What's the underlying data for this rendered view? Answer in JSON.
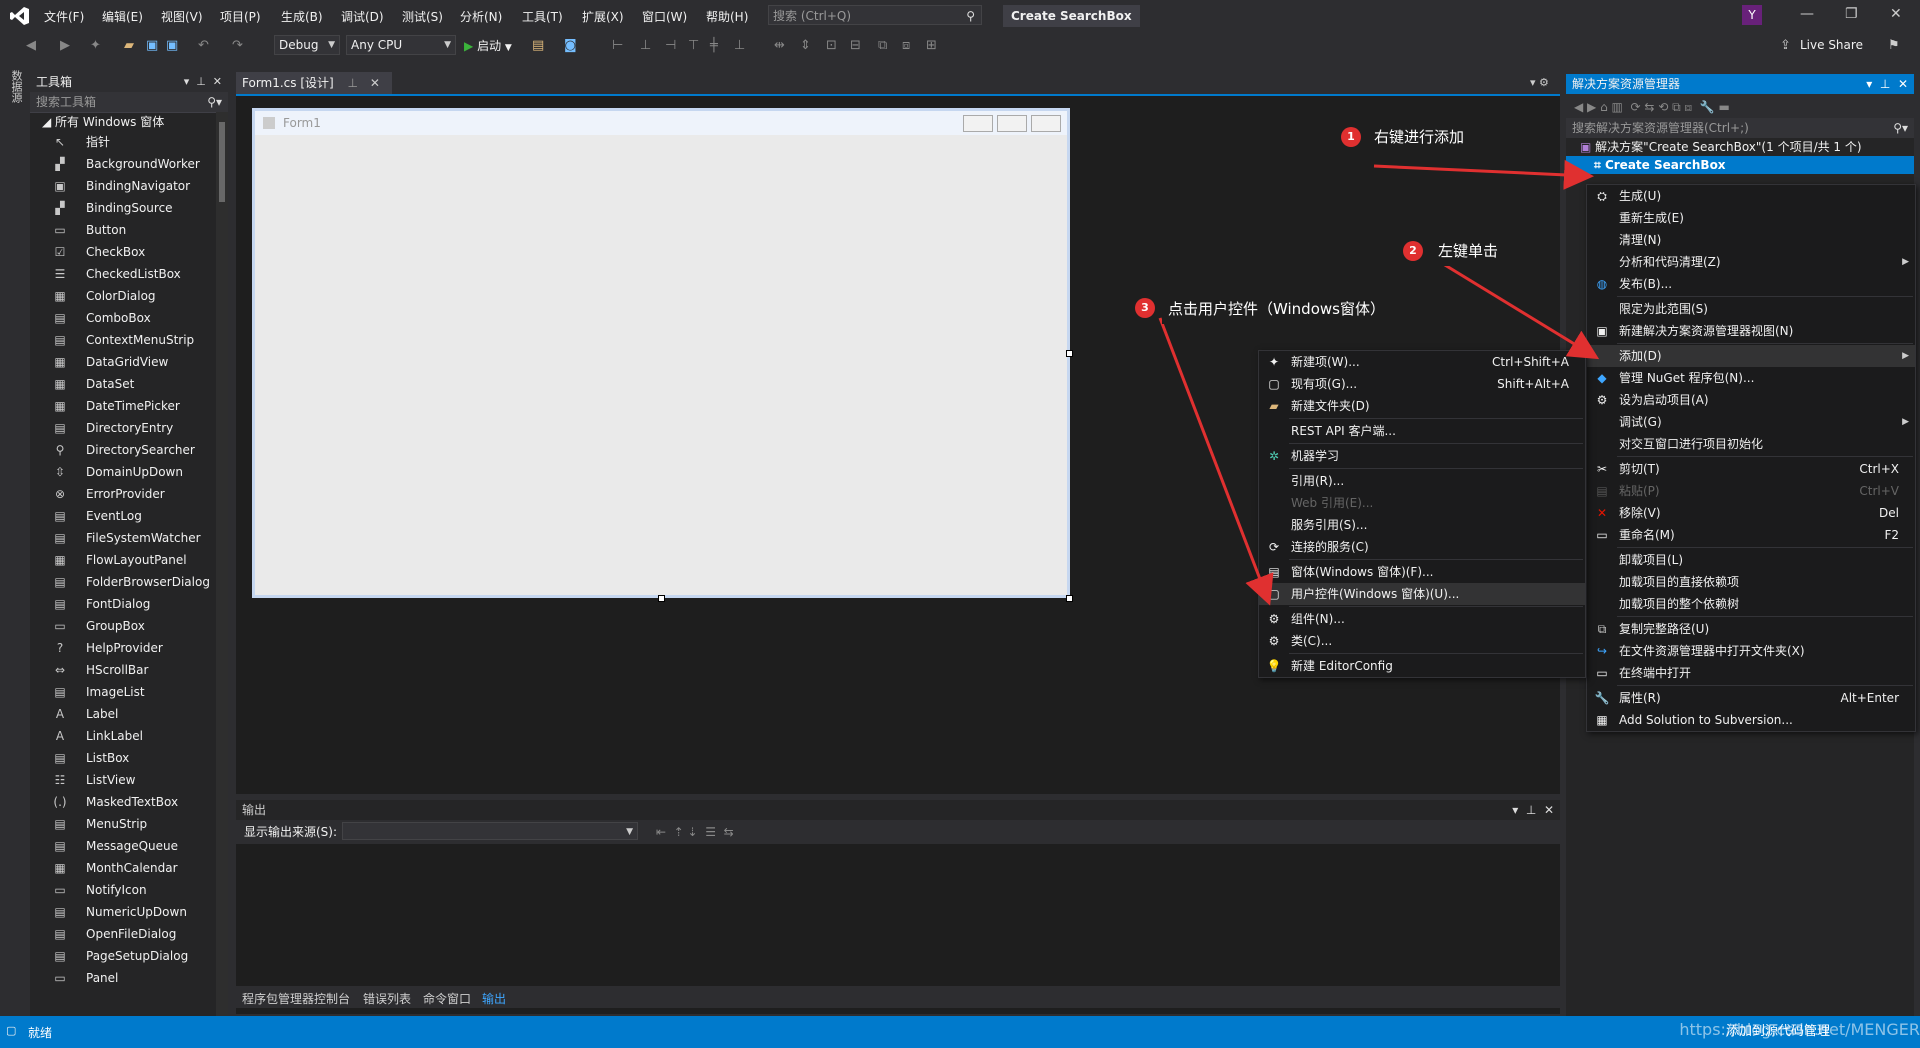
{
  "menubar": {
    "items": [
      "文件(F)",
      "编辑(E)",
      "视图(V)",
      "项目(P)",
      "生成(B)",
      "调试(D)",
      "测试(S)",
      "分析(N)",
      "工具(T)",
      "扩展(X)",
      "窗口(W)",
      "帮助(H)"
    ],
    "search_placeholder": "搜索 (Ctrl+Q)",
    "title": "Create SearchBox",
    "avatar": "Y"
  },
  "toolbar": {
    "config": "Debug",
    "platform": "Any CPU",
    "start": "启动",
    "live_share": "Live Share"
  },
  "toolbox": {
    "title": "工具箱",
    "search_placeholder": "搜索工具箱",
    "group": "所有 Windows 窗体",
    "items": [
      "指针",
      "BackgroundWorker",
      "BindingNavigator",
      "BindingSource",
      "Button",
      "CheckBox",
      "CheckedListBox",
      "ColorDialog",
      "ComboBox",
      "ContextMenuStrip",
      "DataGridView",
      "DataSet",
      "DateTimePicker",
      "DirectoryEntry",
      "DirectorySearcher",
      "DomainUpDown",
      "ErrorProvider",
      "EventLog",
      "FileSystemWatcher",
      "FlowLayoutPanel",
      "FolderBrowserDialog",
      "FontDialog",
      "GroupBox",
      "HelpProvider",
      "HScrollBar",
      "ImageList",
      "Label",
      "LinkLabel",
      "ListBox",
      "ListView",
      "MaskedTextBox",
      "MenuStrip",
      "MessageQueue",
      "MonthCalendar",
      "NotifyIcon",
      "NumericUpDown",
      "OpenFileDialog",
      "PageSetupDialog",
      "Panel"
    ]
  },
  "left_strip_label": "数据源",
  "document": {
    "tab_label": "Form1.cs [设计]",
    "form_title": "Form1"
  },
  "output": {
    "title": "输出",
    "source_label": "显示输出来源(S):",
    "tabs": [
      "程序包管理器控制台",
      "错误列表",
      "命令窗口",
      "输出"
    ]
  },
  "solution_explorer": {
    "title": "解决方案资源管理器",
    "search_placeholder": "搜索解决方案资源管理器(Ctrl+;)",
    "solution_node": "解决方案\"Create SearchBox\"(1 个项目/共 1 个)",
    "project_node": "Create SearchBox"
  },
  "project_menu": [
    {
      "label": "生成(U)",
      "shortcut": "",
      "icon": "build-icon"
    },
    {
      "label": "重新生成(E)",
      "shortcut": ""
    },
    {
      "label": "清理(N)",
      "shortcut": ""
    },
    {
      "label": "分析和代码清理(Z)",
      "shortcut": "",
      "sub": true
    },
    {
      "label": "发布(B)...",
      "shortcut": "",
      "icon": "globe-icon"
    },
    {
      "sep": true
    },
    {
      "label": "限定为此范围(S)",
      "shortcut": ""
    },
    {
      "label": "新建解决方案资源管理器视图(N)",
      "shortcut": "",
      "icon": "window-icon"
    },
    {
      "sep": true
    },
    {
      "label": "添加(D)",
      "shortcut": "",
      "sub": true,
      "hl": true
    },
    {
      "label": "管理 NuGet 程序包(N)...",
      "shortcut": "",
      "icon": "nuget-icon"
    },
    {
      "label": "设为启动项目(A)",
      "shortcut": "",
      "icon": "gear-icon"
    },
    {
      "label": "调试(G)",
      "shortcut": "",
      "sub": true
    },
    {
      "label": "对交互窗口进行项目初始化",
      "shortcut": ""
    },
    {
      "sep": true
    },
    {
      "label": "剪切(T)",
      "shortcut": "Ctrl+X",
      "icon": "cut-icon"
    },
    {
      "label": "粘贴(P)",
      "shortcut": "Ctrl+V",
      "icon": "paste-icon",
      "dis": true
    },
    {
      "label": "移除(V)",
      "shortcut": "Del",
      "icon": "remove-icon"
    },
    {
      "label": "重命名(M)",
      "shortcut": "F2",
      "icon": "rename-icon"
    },
    {
      "sep": true
    },
    {
      "label": "卸载项目(L)",
      "shortcut": ""
    },
    {
      "label": "加载项目的直接依赖项",
      "shortcut": ""
    },
    {
      "label": "加载项目的整个依赖树",
      "shortcut": ""
    },
    {
      "sep": true
    },
    {
      "label": "复制完整路径(U)",
      "shortcut": "",
      "icon": "copy-icon"
    },
    {
      "label": "在文件资源管理器中打开文件夹(X)",
      "shortcut": "",
      "icon": "folder-open-icon"
    },
    {
      "label": "在终端中打开",
      "shortcut": "",
      "icon": "terminal-icon"
    },
    {
      "sep": true
    },
    {
      "label": "属性(R)",
      "shortcut": "Alt+Enter",
      "icon": "wrench-icon"
    },
    {
      "label": "Add Solution to Subversion...",
      "shortcut": "",
      "icon": "svn-icon"
    }
  ],
  "add_menu": [
    {
      "label": "新建项(W)...",
      "shortcut": "Ctrl+Shift+A",
      "icon": "new-item-icon"
    },
    {
      "label": "现有项(G)...",
      "shortcut": "Shift+Alt+A",
      "icon": "existing-item-icon"
    },
    {
      "label": "新建文件夹(D)",
      "shortcut": "",
      "icon": "folder-icon"
    },
    {
      "sep": true
    },
    {
      "label": "REST API 客户端...",
      "shortcut": ""
    },
    {
      "sep": true
    },
    {
      "label": "机器学习",
      "shortcut": "",
      "icon": "ml-icon"
    },
    {
      "sep": true
    },
    {
      "label": "引用(R)...",
      "shortcut": ""
    },
    {
      "label": "Web 引用(E)...",
      "shortcut": "",
      "dis": true
    },
    {
      "label": "服务引用(S)...",
      "shortcut": ""
    },
    {
      "label": "连接的服务(C)",
      "shortcut": "",
      "icon": "connected-icon"
    },
    {
      "sep": true
    },
    {
      "label": "窗体(Windows 窗体)(F)...",
      "shortcut": "",
      "icon": "form-icon"
    },
    {
      "label": "用户控件(Windows 窗体)(U)...",
      "shortcut": "",
      "icon": "usercontrol-icon",
      "hl": true
    },
    {
      "sep": true
    },
    {
      "label": "组件(N)...",
      "shortcut": "",
      "icon": "component-icon"
    },
    {
      "label": "类(C)...",
      "shortcut": "",
      "icon": "class-icon"
    },
    {
      "sep": true
    },
    {
      "label": "新建 EditorConfig",
      "shortcut": "",
      "icon": "bulb-icon"
    }
  ],
  "annotations": [
    {
      "num": "1",
      "text": "右键进行添加"
    },
    {
      "num": "2",
      "text": "左键单击"
    },
    {
      "num": "3",
      "text": "点击用户控件（Windows窗体）"
    }
  ],
  "status": {
    "text": "就绪",
    "add_to_source": "添加到源代码管理",
    "watermark": "https://blog.csdn.net/MENGER"
  },
  "colors": {
    "accent": "#007acc",
    "annotation": "#e03030"
  }
}
